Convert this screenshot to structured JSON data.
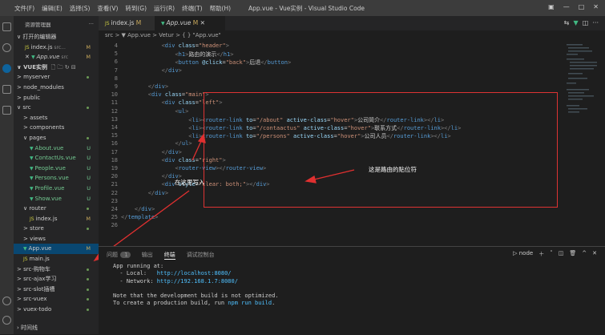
{
  "menu": [
    "文件(F)",
    "编辑(E)",
    "选择(S)",
    "查看(V)",
    "转到(G)",
    "运行(R)",
    "终端(T)",
    "帮助(H)"
  ],
  "window_title": "App.vue - Vue实例 - Visual Studio Code",
  "sidebar": {
    "header": "资源管理器",
    "open_editors": "打开的编辑器",
    "open_files": [
      {
        "icon": "JS",
        "name": "index.js",
        "path": "src...",
        "badge": "M"
      },
      {
        "icon": "V",
        "name": "App.vue",
        "path": "src",
        "badge": "M"
      }
    ],
    "workspace": "VUE实例",
    "tree": [
      {
        "name": "myserver",
        "indent": 1,
        "arrow": ">",
        "badge": "dot"
      },
      {
        "name": "node_modules",
        "indent": 1,
        "arrow": ">",
        "badge": ""
      },
      {
        "name": "public",
        "indent": 1,
        "arrow": ">",
        "badge": ""
      },
      {
        "name": "src",
        "indent": 1,
        "arrow": "∨",
        "badge": "dot"
      },
      {
        "name": "assets",
        "indent": 2,
        "arrow": ">",
        "badge": ""
      },
      {
        "name": "components",
        "indent": 2,
        "arrow": ">",
        "badge": ""
      },
      {
        "name": "pages",
        "indent": 2,
        "arrow": "∨",
        "badge": "dot"
      },
      {
        "name": "About.vue",
        "indent": 3,
        "icon": "V",
        "badge": "U"
      },
      {
        "name": "ContactUs.vue",
        "indent": 3,
        "icon": "V",
        "badge": "U"
      },
      {
        "name": "People.vue",
        "indent": 3,
        "icon": "V",
        "badge": "U"
      },
      {
        "name": "Persons.vue",
        "indent": 3,
        "icon": "V",
        "badge": "U"
      },
      {
        "name": "Profile.vue",
        "indent": 3,
        "icon": "V",
        "badge": "U"
      },
      {
        "name": "Show.vue",
        "indent": 3,
        "icon": "V",
        "badge": "U"
      },
      {
        "name": "router",
        "indent": 2,
        "arrow": "∨",
        "badge": "dot"
      },
      {
        "name": "index.js",
        "indent": 3,
        "icon": "JS",
        "badge": "M"
      },
      {
        "name": "store",
        "indent": 2,
        "arrow": ">",
        "badge": "dot"
      },
      {
        "name": "views",
        "indent": 2,
        "arrow": ">",
        "badge": ""
      },
      {
        "name": "App.vue",
        "indent": 2,
        "icon": "V",
        "badge": "M",
        "selected": true
      },
      {
        "name": "main.js",
        "indent": 2,
        "icon": "JS",
        "badge": ""
      },
      {
        "name": "src-购物车",
        "indent": 1,
        "arrow": ">",
        "badge": "dot"
      },
      {
        "name": "src-ajax学习",
        "indent": 1,
        "arrow": ">",
        "badge": "dot"
      },
      {
        "name": "src-slot插槽",
        "indent": 1,
        "arrow": ">",
        "badge": "dot"
      },
      {
        "name": "src-vuex",
        "indent": 1,
        "arrow": ">",
        "badge": "dot"
      },
      {
        "name": "vuex-todo",
        "indent": 1,
        "arrow": ">",
        "badge": "dot"
      }
    ],
    "outline": "时间线"
  },
  "tabs": [
    {
      "icon": "JS",
      "label": "index.js",
      "badge": "M",
      "active": false
    },
    {
      "icon": "V",
      "label": "App.vue",
      "badge": "M",
      "active": true
    }
  ],
  "breadcrumb": "src > ▼ App.vue > Vetur > { } \"App.vue\"",
  "code_lines": [
    {
      "n": "4",
      "html": "            <span class='p'>&lt;</span><span class='t'>div</span> <span class='a'>class</span>=<span class='s'>\"header\"</span><span class='p'>&gt;</span>"
    },
    {
      "n": "5",
      "html": "                <span class='p'>&lt;</span><span class='t'>h1</span><span class='p'>&gt;</span>路由的演示<span class='p'>&lt;/</span><span class='t'>h1</span><span class='p'>&gt;</span>"
    },
    {
      "n": "6",
      "html": "                <span class='p'>&lt;</span><span class='t'>button</span> <span class='a'>@click</span>=<span class='s'>\"back\"</span><span class='p'>&gt;</span>后退<span class='p'>&lt;/</span><span class='t'>button</span><span class='p'>&gt;</span>"
    },
    {
      "n": "7",
      "html": "            <span class='p'>&lt;/</span><span class='t'>div</span><span class='p'>&gt;</span>"
    },
    {
      "n": "8",
      "html": ""
    },
    {
      "n": "9",
      "html": "        <span class='p'>&lt;/</span><span class='t'>div</span><span class='p'>&gt;</span>"
    },
    {
      "n": "10",
      "html": "        <span class='p'>&lt;</span><span class='t'>div</span> <span class='a'>class</span>=<span class='s'>\"main\"</span><span class='p'>&gt;</span>"
    },
    {
      "n": "11",
      "html": "            <span class='p'>&lt;</span><span class='t'>div</span> <span class='a'>class</span>=<span class='s'>\"left\"</span><span class='p'>&gt;</span>"
    },
    {
      "n": "12",
      "html": "                <span class='p'>&lt;</span><span class='t'>ul</span><span class='p'>&gt;</span>"
    },
    {
      "n": "13",
      "html": "                    <span class='p'>&lt;</span><span class='t'>li</span><span class='p'>&gt;&lt;</span><span class='t'>router-link</span> <span class='a'>to</span>=<span class='s'>\"/about\"</span> <span class='a'>active-class</span>=<span class='s'>\"hover\"</span><span class='p'>&gt;</span>公司简介<span class='p'>&lt;/</span><span class='t'>router-link</span><span class='p'>&gt;&lt;/</span><span class='t'>li</span><span class='p'>&gt;</span>"
    },
    {
      "n": "14",
      "html": "                    <span class='p'>&lt;</span><span class='t'>li</span><span class='p'>&gt;&lt;</span><span class='t'>router-link</span> <span class='a'>to</span>=<span class='s'>\"/contaactus\"</span> <span class='a'>active-class</span>=<span class='s'>\"hover\"</span><span class='p'>&gt;</span>联系方式<span class='p'>&lt;/</span><span class='t'>router-link</span><span class='p'>&gt;&lt;/</span><span class='t'>li</span><span class='p'>&gt;</span>"
    },
    {
      "n": "15",
      "html": "                    <span class='p'>&lt;</span><span class='t'>li</span><span class='p'>&gt;&lt;</span><span class='t'>router-link</span> <span class='a'>to</span>=<span class='s'>\"/persons\"</span> <span class='a'>active-class</span>=<span class='s'>\"hover\"</span><span class='p'>&gt;</span>公司人员<span class='p'>&lt;/</span><span class='t'>router-link</span><span class='p'>&gt;&lt;/</span><span class='t'>li</span><span class='p'>&gt;</span>"
    },
    {
      "n": "16",
      "html": "                <span class='p'>&lt;/</span><span class='t'>ul</span><span class='p'>&gt;</span>"
    },
    {
      "n": "17",
      "html": "            <span class='p'>&lt;/</span><span class='t'>div</span><span class='p'>&gt;</span>"
    },
    {
      "n": "18",
      "html": "            <span class='p'>&lt;</span><span class='t'>div</span> <span class='a'>class</span>=<span class='s'>\"right\"</span><span class='p'>&gt;</span>"
    },
    {
      "n": "19",
      "html": "                <span class='p'>&lt;</span><span class='t'>router-view</span><span class='p'>&gt;&lt;/</span><span class='t'>router-view</span><span class='p'>&gt;</span>"
    },
    {
      "n": "20",
      "html": "            <span class='p'>&lt;/</span><span class='t'>div</span><span class='p'>&gt;</span>"
    },
    {
      "n": "21",
      "html": "            <span class='p'>&lt;</span><span class='t'>div</span> <span class='a'>style</span>=<span class='s'>\"clear: both;\"</span><span class='p'>&gt;&lt;/</span><span class='t'>div</span><span class='p'>&gt;</span>"
    },
    {
      "n": "22",
      "html": "        <span class='p'>&lt;/</span><span class='t'>div</span><span class='p'>&gt;</span>"
    },
    {
      "n": "23",
      "html": ""
    },
    {
      "n": "24",
      "html": "    <span class='p'>&lt;/</span><span class='t'>div</span><span class='p'>&gt;</span>"
    },
    {
      "n": "25",
      "html": "<span class='p'>&lt;/</span><span class='t'>template</span><span class='p'>&gt;</span>"
    },
    {
      "n": "26",
      "html": ""
    }
  ],
  "annotations": {
    "router_view_note": "这是路由的贴位符",
    "write_here_note": "在这里写入"
  },
  "panel": {
    "tabs": [
      {
        "label": "问题",
        "count": "1",
        "active": false
      },
      {
        "label": "输出",
        "active": false
      },
      {
        "label": "终端",
        "active": true
      },
      {
        "label": "调试控制台",
        "active": false
      }
    ],
    "terminal_name": "node",
    "terminal_lines": [
      {
        "text": "App running at:"
      },
      {
        "text": "  - Local:   ",
        "url": "http://localhost:8080/"
      },
      {
        "text": "  - Network: ",
        "url": "http://192.168.1.7:8080/"
      },
      {
        "text": ""
      },
      {
        "text": "Note that the development build is not optimized."
      },
      {
        "text": "To create a production build, run ",
        "url": "npm run build",
        "tail": "."
      }
    ]
  },
  "colors": {
    "accent": "#0e639c",
    "vue": "#41b883",
    "red": "#e03030"
  }
}
